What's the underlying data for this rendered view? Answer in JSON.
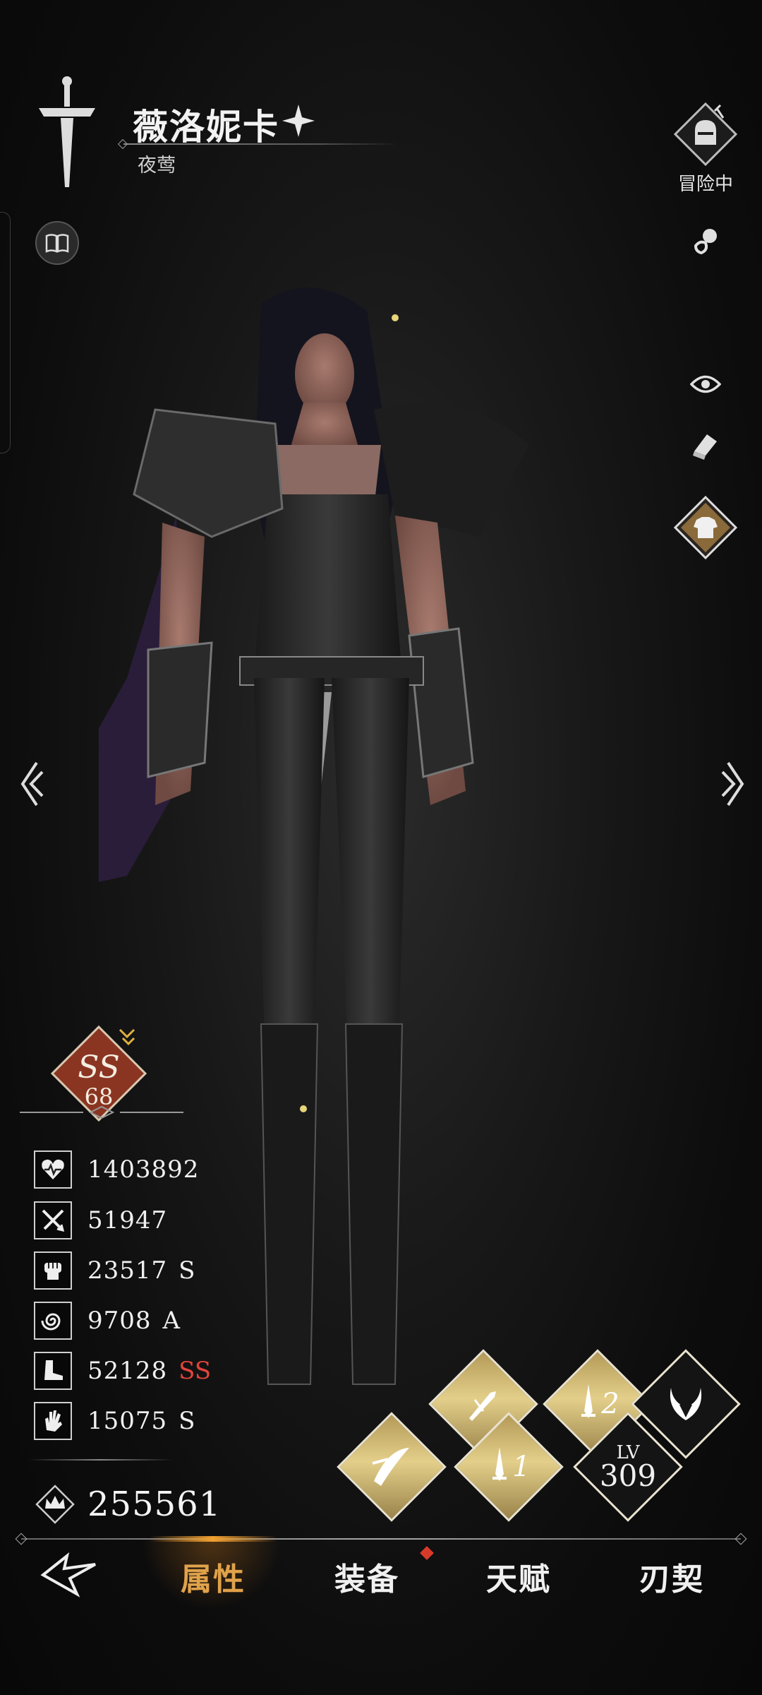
{
  "header": {
    "name": "薇洛妮卡",
    "title": "夜莺",
    "status_label": "冒险中"
  },
  "icons": {
    "logo": "sword-icon",
    "book": "book-icon",
    "adventure": "knight-helmet-icon",
    "pacifier": "pacifier-icon",
    "eye": "eye-icon",
    "eraser": "eraser-icon",
    "outfit": "shirt-icon",
    "prev": "chevron-left-icon",
    "next": "chevron-right-icon"
  },
  "rank": {
    "grade": "SS",
    "level": "68"
  },
  "stats": [
    {
      "icon": "heart-icon",
      "value": "1403892",
      "grade": ""
    },
    {
      "icon": "crossed-swords-icon",
      "value": "51947",
      "grade": ""
    },
    {
      "icon": "fist-icon",
      "value": "23517",
      "grade": "S"
    },
    {
      "icon": "spiral-icon",
      "value": "9708",
      "grade": "A"
    },
    {
      "icon": "boot-icon",
      "value": "52128",
      "grade": "SS"
    },
    {
      "icon": "hand-icon",
      "value": "15075",
      "grade": "S"
    }
  ],
  "power": {
    "icon": "crown-icon",
    "value": "255561"
  },
  "skills": {
    "s1_num": "1",
    "s2_num": "2",
    "lv_label": "LV",
    "lv_value": "309"
  },
  "nav": {
    "tabs": [
      "属性",
      "装备",
      "天赋",
      "刃契"
    ],
    "active_index": 0
  },
  "colors": {
    "accent_gold": "#e0a24a",
    "grade_ss_red": "#e2443a",
    "rank_badge": "#8a3522"
  }
}
